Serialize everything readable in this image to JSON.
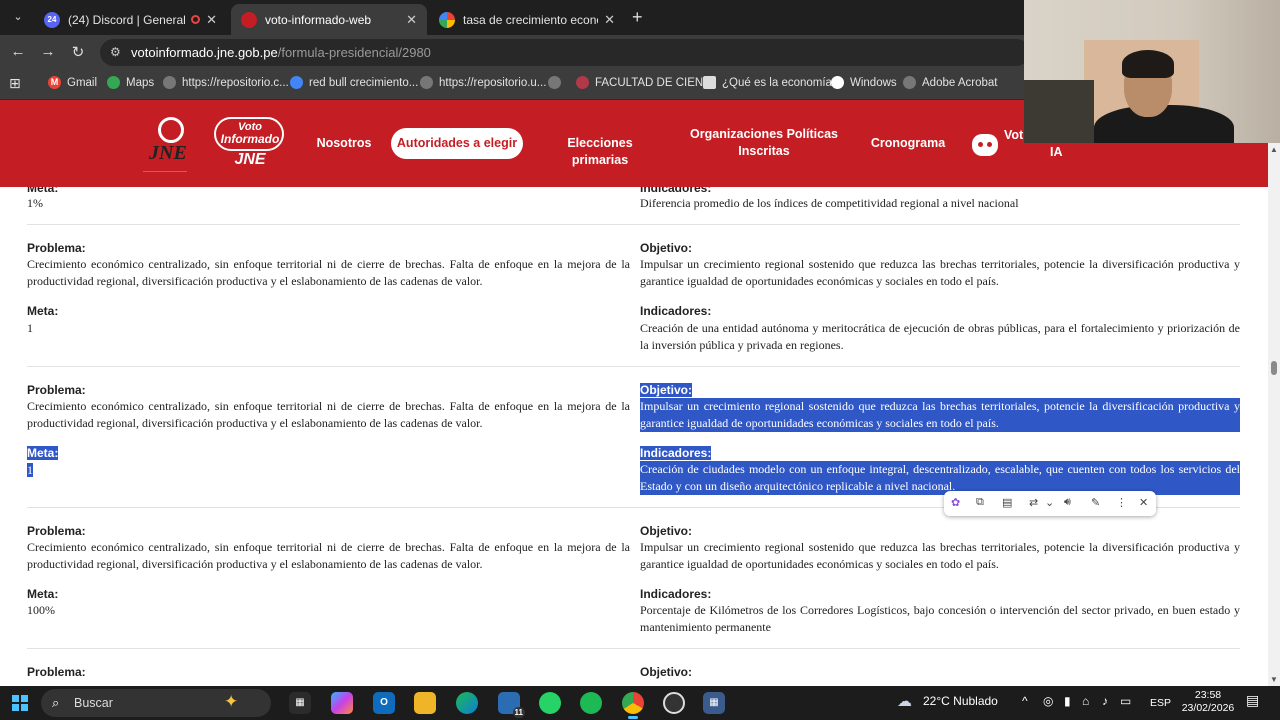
{
  "browser": {
    "tabs": [
      {
        "title": "(24) Discord | General | IRO",
        "badge": "24",
        "active": false
      },
      {
        "title": "voto-informado-web",
        "active": true
      },
      {
        "title": "tasa de crecimiento economico",
        "active": false
      }
    ],
    "url_host": "votoinformado.jne.gob.pe",
    "url_path": "/formula-presidencial/2980",
    "bookmarks": [
      {
        "label": "Gmail"
      },
      {
        "label": "Maps"
      },
      {
        "label": "https://repositorio.c..."
      },
      {
        "label": "red bull crecimiento..."
      },
      {
        "label": "https://repositorio.u..."
      },
      {
        "label": ""
      },
      {
        "label": "FACULTAD DE CIEN..."
      },
      {
        "label": "¿Qué es la economía?"
      },
      {
        "label": "Windows"
      },
      {
        "label": "Adobe Acrobat"
      }
    ]
  },
  "site": {
    "logo_jne": "JNE",
    "logo_voto_l1": "Voto",
    "logo_voto_l2": "Informado",
    "logo_voto_l3": "JNE",
    "nav": {
      "nosotros": "Nosotros",
      "autoridades": "Autoridades a elegir",
      "elecciones": "Elecciones primarias",
      "organizaciones_l1": "Organizaciones Políticas",
      "organizaciones_l2": "Inscritas",
      "cronograma": "Cronograma",
      "voto_ia_l1": "Vot",
      "voto_ia_l2": "IA"
    }
  },
  "labels": {
    "problema": "Problema:",
    "objetivo": "Objetivo:",
    "meta": "Meta:",
    "indicadores": "Indicadores:"
  },
  "top_partial": {
    "meta_value": "1%",
    "indicador_text": "Diferencia promedio de los índices de competitividad regional a nivel nacional"
  },
  "rows": [
    {
      "problema": "Crecimiento económico centralizado, sin enfoque territorial ni de cierre de brechas. Falta de enfoque en la mejora de la productividad regional, diversificación productiva y el eslabonamiento de las cadenas de valor.",
      "objetivo": "Impulsar un crecimiento regional sostenido que reduzca las brechas territoriales, potencie la diversificación productiva y garantice igualdad de oportunidades económicas y sociales en todo el país.",
      "meta": "1",
      "indicadores": "Creación de una entidad autónoma y meritocrática de ejecución de obras públicas, para el fortalecimiento y priorización de la inversión pública y privada en regiones."
    },
    {
      "problema": "Crecimiento económico centralizado, sin enfoque territorial ni de cierre de brechas. Falta de enfoque en la mejora de la productividad regional, diversificación productiva y el eslabonamiento de las cadenas de valor.",
      "objetivo": "Impulsar un crecimiento regional sostenido que reduzca las brechas territoriales, potencie la diversificación productiva y garantice igualdad de oportunidades económicas y sociales en todo el país.",
      "meta": "1",
      "indicadores": "Creación de ciudades modelo con un enfoque integral, descentralizado, escalable, que cuenten con todos los servicios del Estado y con un diseño arquitectónico replicable a nivel nacional."
    },
    {
      "problema": "Crecimiento económico centralizado, sin enfoque territorial ni de cierre de brechas. Falta de enfoque en la mejora de la productividad regional, diversificación productiva y el eslabonamiento de las cadenas de valor.",
      "objetivo": "Impulsar un crecimiento regional sostenido que reduzca las brechas territoriales, potencie la diversificación productiva y garantice igualdad de oportunidades económicas y sociales en todo el país.",
      "meta": "100%",
      "indicadores": "Porcentaje de Kilómetros de los Corredores Logísticos, bajo concesión o intervención del sector privado, en buen estado y mantenimiento permanente"
    }
  ],
  "taskbar": {
    "search_placeholder": "Buscar",
    "mail_badge": "11",
    "weather": "22°C Nublado",
    "lang": "ESP",
    "time": "23:58",
    "date": "23/02/2026"
  }
}
